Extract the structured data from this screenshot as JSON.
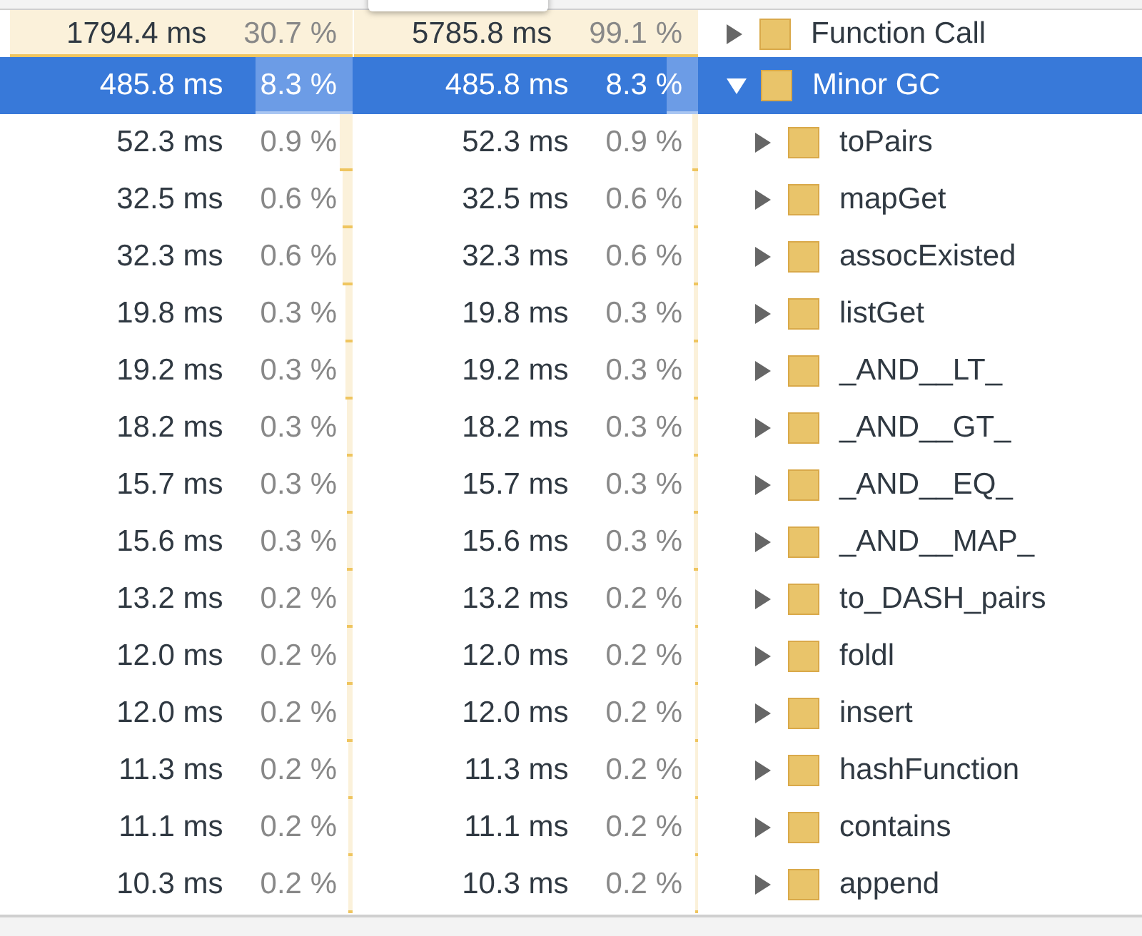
{
  "rows": [
    {
      "self": {
        "time": "1794.4 ms",
        "percent": "30.7 %",
        "level": 1.0
      },
      "total": {
        "time": "5785.8 ms",
        "percent": "99.1 %",
        "level": 0.991
      },
      "name": "Function Call",
      "expanded": false,
      "selected": false
    },
    {
      "self": {
        "time": "485.8 ms",
        "percent": "8.3 %",
        "level": 0.27
      },
      "total": {
        "time": "485.8 ms",
        "percent": "8.3 %",
        "level": 0.083
      },
      "name": "Minor GC",
      "expanded": true,
      "selected": true,
      "children": [
        {
          "self": {
            "time": "52.3 ms",
            "percent": "0.9 %",
            "level": 0.029
          },
          "total": {
            "time": "52.3 ms",
            "percent": "0.9 %",
            "level": 0.009
          },
          "name": "toPairs",
          "expanded": false,
          "selected": false
        },
        {
          "self": {
            "time": "32.5 ms",
            "percent": "0.6 %",
            "level": 0.02
          },
          "total": {
            "time": "32.5 ms",
            "percent": "0.6 %",
            "level": 0.006
          },
          "name": "mapGet",
          "expanded": false,
          "selected": false
        },
        {
          "self": {
            "time": "32.3 ms",
            "percent": "0.6 %",
            "level": 0.02
          },
          "total": {
            "time": "32.3 ms",
            "percent": "0.6 %",
            "level": 0.006
          },
          "name": "assocExisted",
          "expanded": false,
          "selected": false
        },
        {
          "self": {
            "time": "19.8 ms",
            "percent": "0.3 %",
            "level": 0.011
          },
          "total": {
            "time": "19.8 ms",
            "percent": "0.3 %",
            "level": 0.003
          },
          "name": "listGet",
          "expanded": false,
          "selected": false
        },
        {
          "self": {
            "time": "19.2 ms",
            "percent": "0.3 %",
            "level": 0.011
          },
          "total": {
            "time": "19.2 ms",
            "percent": "0.3 %",
            "level": 0.003
          },
          "name": "_AND__LT_",
          "expanded": false,
          "selected": false
        },
        {
          "self": {
            "time": "18.2 ms",
            "percent": "0.3 %",
            "level": 0.01
          },
          "total": {
            "time": "18.2 ms",
            "percent": "0.3 %",
            "level": 0.003
          },
          "name": "_AND__GT_",
          "expanded": false,
          "selected": false
        },
        {
          "self": {
            "time": "15.7 ms",
            "percent": "0.3 %",
            "level": 0.009
          },
          "total": {
            "time": "15.7 ms",
            "percent": "0.3 %",
            "level": 0.003
          },
          "name": "_AND__EQ_",
          "expanded": false,
          "selected": false
        },
        {
          "self": {
            "time": "15.6 ms",
            "percent": "0.3 %",
            "level": 0.009
          },
          "total": {
            "time": "15.6 ms",
            "percent": "0.3 %",
            "level": 0.003
          },
          "name": "_AND__MAP_",
          "expanded": false,
          "selected": false
        },
        {
          "self": {
            "time": "13.2 ms",
            "percent": "0.2 %",
            "level": 0.007
          },
          "total": {
            "time": "13.2 ms",
            "percent": "0.2 %",
            "level": 0.002
          },
          "name": "to_DASH_pairs",
          "expanded": false,
          "selected": false
        },
        {
          "self": {
            "time": "12.0 ms",
            "percent": "0.2 %",
            "level": 0.007
          },
          "total": {
            "time": "12.0 ms",
            "percent": "0.2 %",
            "level": 0.002
          },
          "name": "foldl",
          "expanded": false,
          "selected": false
        },
        {
          "self": {
            "time": "12.0 ms",
            "percent": "0.2 %",
            "level": 0.007
          },
          "total": {
            "time": "12.0 ms",
            "percent": "0.2 %",
            "level": 0.002
          },
          "name": "insert",
          "expanded": false,
          "selected": false
        },
        {
          "self": {
            "time": "11.3 ms",
            "percent": "0.2 %",
            "level": 0.006
          },
          "total": {
            "time": "11.3 ms",
            "percent": "0.2 %",
            "level": 0.002
          },
          "name": "hashFunction",
          "expanded": false,
          "selected": false
        },
        {
          "self": {
            "time": "11.1 ms",
            "percent": "0.2 %",
            "level": 0.006
          },
          "total": {
            "time": "11.1 ms",
            "percent": "0.2 %",
            "level": 0.002
          },
          "name": "contains",
          "expanded": false,
          "selected": false
        },
        {
          "self": {
            "time": "10.3 ms",
            "percent": "0.2 %",
            "level": 0.006
          },
          "total": {
            "time": "10.3 ms",
            "percent": "0.2 %",
            "level": 0.002
          },
          "name": "append",
          "expanded": false,
          "selected": false
        }
      ]
    }
  ]
}
